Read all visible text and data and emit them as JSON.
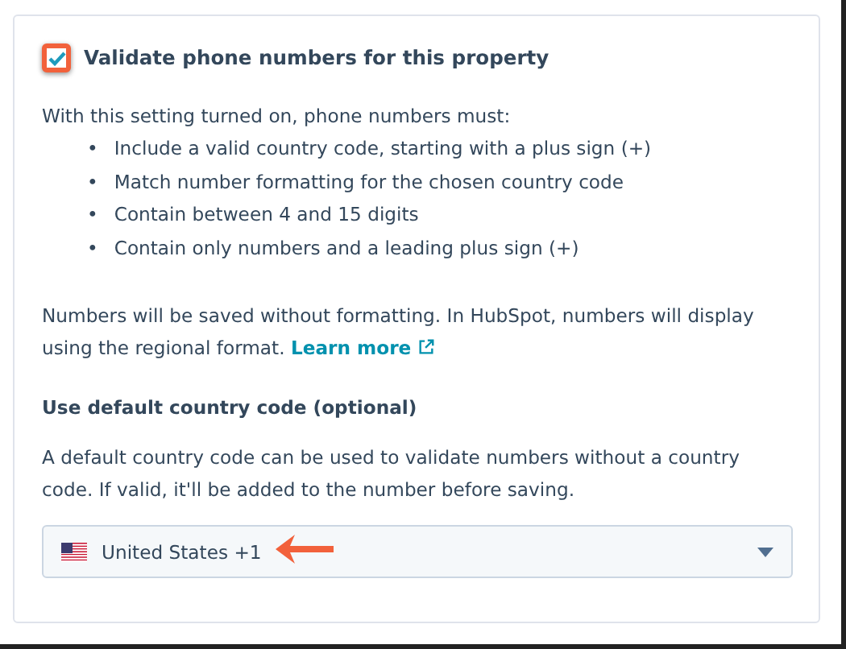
{
  "validate": {
    "label": "Validate phone numbers for this property",
    "checked": true
  },
  "rules_intro": "With this setting turned on, phone numbers must:",
  "rules": [
    {
      "bullet": "•",
      "text": "Include a valid country code, starting with a plus sign (+)"
    },
    {
      "bullet": "•",
      "text": "Match number formatting for the chosen country code"
    },
    {
      "bullet": "•",
      "text": "Contain between 4 and 15 digits"
    },
    {
      "bullet": "•",
      "text": "Contain only numbers and a leading plus sign (+)"
    }
  ],
  "note": {
    "text": "Numbers will be saved without formatting. In HubSpot, numbers will display using the regional format.",
    "link": "Learn more"
  },
  "default_code": {
    "heading": "Use default country code (optional)",
    "help": "A default country code can be used to validate numbers without a country code. If valid, it'll be added to the number before saving.",
    "value": "United States +1"
  }
}
